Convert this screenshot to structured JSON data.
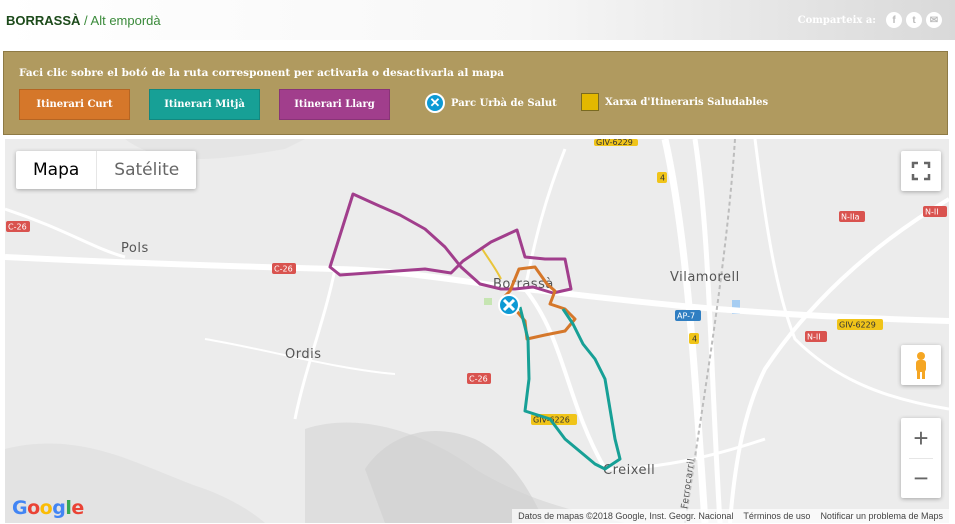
{
  "header": {
    "place_name": "BORRASSÀ",
    "separator": " / ",
    "region": "Alt empordà",
    "share_label": "Comparteix a:",
    "share_icons": [
      {
        "icon": "facebook-icon",
        "glyph": "f"
      },
      {
        "icon": "twitter-icon",
        "glyph": "t"
      },
      {
        "icon": "email-icon",
        "glyph": "✉"
      }
    ]
  },
  "routes_panel": {
    "instruction": "Faci clic sobre el botó de la ruta corresponent per activarla o desactivarla al mapa",
    "buttons": [
      {
        "label": "Itinerari Curt",
        "color": "#d5772a"
      },
      {
        "label": "Itinerari Mitjà",
        "color": "#17a096"
      },
      {
        "label": "Itinerari Llarg",
        "color": "#a13e8c"
      }
    ],
    "legend": [
      {
        "icon": "park-marker-icon",
        "label": "Parc Urbà de Salut"
      },
      {
        "icon": "network-square-icon",
        "label": "Xarxa d'Itineraris Saludables",
        "color": "#e3b800"
      }
    ]
  },
  "map": {
    "type_toggle": {
      "map_label": "Mapa",
      "satellite_label": "Satélite",
      "selected": "Mapa"
    },
    "zoom_in_label": "+",
    "zoom_out_label": "−",
    "logo": "Google",
    "attribution": {
      "data": "Datos de mapas ©2018 Google, Inst. Geogr. Nacional",
      "terms": "Términos de uso",
      "report": "Notificar un problema de Maps"
    },
    "place_labels": [
      "Pols",
      "Borrassà",
      "Vilamorell",
      "Ordis",
      "Creixell",
      "Ferrocarril"
    ],
    "road_labels": [
      "C-26",
      "C-26",
      "C-26",
      "GIV-6229",
      "4",
      "4",
      "N-IIa",
      "N-II",
      "AP-7",
      "N-II",
      "GIV-6229",
      "GIV-6226"
    ]
  }
}
